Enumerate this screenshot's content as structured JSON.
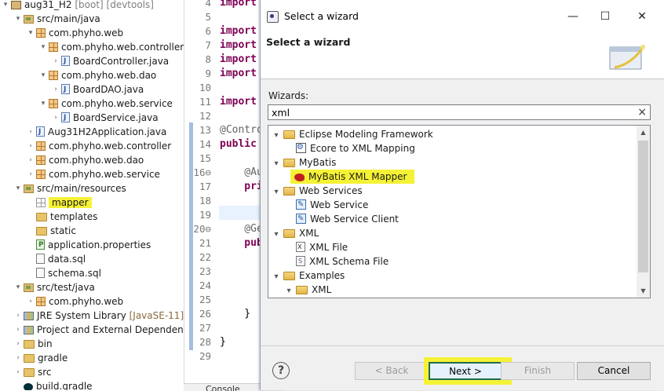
{
  "explorer": {
    "rows": [
      {
        "twisty": "▾",
        "icon": "project",
        "label": "aug31_H2",
        "suffix": " [boot] [devtools]"
      },
      {
        "twisty": "▾",
        "icon": "srcfolder",
        "label": "src/main/java"
      },
      {
        "twisty": "▾",
        "icon": "pkg",
        "label": "com.phyho.web"
      },
      {
        "twisty": "▾",
        "icon": "pkg",
        "label": "com.phyho.web.controller"
      },
      {
        "twisty": "›",
        "icon": "java",
        "label": "BoardController.java"
      },
      {
        "twisty": "▾",
        "icon": "pkg",
        "label": "com.phyho.web.dao"
      },
      {
        "twisty": "›",
        "icon": "java",
        "label": "BoardDAO.java"
      },
      {
        "twisty": "▾",
        "icon": "pkg",
        "label": "com.phyho.web.service"
      },
      {
        "twisty": "›",
        "icon": "java",
        "label": "BoardService.java"
      },
      {
        "twisty": "›",
        "icon": "java",
        "label": "Aug31H2Application.java"
      },
      {
        "twisty": "›",
        "icon": "pkg",
        "label": "com.phyho.web.controller"
      },
      {
        "twisty": "›",
        "icon": "pkg",
        "label": "com.phyho.web.dao"
      },
      {
        "twisty": "›",
        "icon": "pkg",
        "label": "com.phyho.web.service"
      },
      {
        "twisty": "▾",
        "icon": "srcfolder",
        "label": "src/main/resources"
      },
      {
        "twisty": "",
        "icon": "pkg-empty",
        "label": "mapper",
        "highlight": true
      },
      {
        "twisty": "",
        "icon": "folder",
        "label": "templates"
      },
      {
        "twisty": "",
        "icon": "folder",
        "label": "static"
      },
      {
        "twisty": "",
        "icon": "props",
        "label": "application.properties"
      },
      {
        "twisty": "",
        "icon": "file",
        "label": "data.sql"
      },
      {
        "twisty": "",
        "icon": "file",
        "label": "schema.sql"
      },
      {
        "twisty": "▾",
        "icon": "srcfolder",
        "label": "src/test/java"
      },
      {
        "twisty": "›",
        "icon": "pkg",
        "label": "com.phyho.web"
      },
      {
        "twisty": "›",
        "icon": "lib",
        "label": "JRE System Library",
        "suffix": " [JavaSE-11]"
      },
      {
        "twisty": "›",
        "icon": "lib",
        "label": "Project and External Dependencies"
      },
      {
        "twisty": "›",
        "icon": "folder",
        "label": "bin"
      },
      {
        "twisty": "›",
        "icon": "folder",
        "label": "gradle"
      },
      {
        "twisty": "›",
        "icon": "folder",
        "label": "src"
      },
      {
        "twisty": "",
        "icon": "gradle",
        "label": "build.gradle"
      }
    ]
  },
  "editor": {
    "lines": [
      {
        "n": "4",
        "code": "import java.util.Map;"
      },
      {
        "n": "5",
        "code": ""
      },
      {
        "n": "6",
        "code": "import"
      },
      {
        "n": "7",
        "code": "import"
      },
      {
        "n": "8",
        "code": "import"
      },
      {
        "n": "9",
        "code": "import"
      },
      {
        "n": "10",
        "code": ""
      },
      {
        "n": "11",
        "code": "import"
      },
      {
        "n": "12",
        "code": ""
      },
      {
        "n": "13",
        "code": "@Contro"
      },
      {
        "n": "14",
        "code": "public"
      },
      {
        "n": "15",
        "code": ""
      },
      {
        "n": "16⊖",
        "code": "    @Au"
      },
      {
        "n": "17",
        "code": "    pri"
      },
      {
        "n": "18",
        "code": ""
      },
      {
        "n": "19",
        "code": ""
      },
      {
        "n": "20⊖",
        "code": "    @Ge"
      },
      {
        "n": "21",
        "code": "    pub"
      },
      {
        "n": "22",
        "code": ""
      },
      {
        "n": "23",
        "code": ""
      },
      {
        "n": "24",
        "code": ""
      },
      {
        "n": "25",
        "code": ""
      },
      {
        "n": "26",
        "code": "    }"
      },
      {
        "n": "27",
        "code": ""
      },
      {
        "n": "28",
        "code": "}"
      },
      {
        "n": "29",
        "code": ""
      }
    ],
    "console_tab": "Console"
  },
  "dialog": {
    "title": "Select a wizard",
    "header": "Select a wizard",
    "wizards_label": "Wizards:",
    "filter_value": "xml",
    "clear_glyph": "×",
    "minimize_glyph": "—",
    "maximize_glyph": "☐",
    "close_glyph": "✕",
    "tree": [
      {
        "indent": 0,
        "twisty": "▾",
        "icon": "folder",
        "label": "Eclipse Modeling Framework"
      },
      {
        "indent": 1,
        "twisty": "",
        "icon": "ecore",
        "label": "Ecore to XML Mapping"
      },
      {
        "indent": 0,
        "twisty": "▾",
        "icon": "folder",
        "label": "MyBatis"
      },
      {
        "indent": 1,
        "twisty": "",
        "icon": "bird",
        "label": "MyBatis XML Mapper",
        "highlight": true
      },
      {
        "indent": 0,
        "twisty": "▾",
        "icon": "folder",
        "label": "Web Services"
      },
      {
        "indent": 1,
        "twisty": "",
        "icon": "ws",
        "label": "Web Service"
      },
      {
        "indent": 1,
        "twisty": "",
        "icon": "ws",
        "label": "Web Service Client"
      },
      {
        "indent": 0,
        "twisty": "▾",
        "icon": "folder",
        "label": "XML"
      },
      {
        "indent": 1,
        "twisty": "",
        "icon": "xml",
        "label": "XML File"
      },
      {
        "indent": 1,
        "twisty": "",
        "icon": "xsd",
        "label": "XML Schema File"
      },
      {
        "indent": 0,
        "twisty": "▾",
        "icon": "folder",
        "label": "Examples"
      },
      {
        "indent": 1,
        "twisty": "▾",
        "icon": "folder",
        "label": "XML"
      }
    ],
    "buttons": {
      "help": "?",
      "back": "< Back",
      "next": "Next >",
      "finish": "Finish",
      "cancel": "Cancel"
    },
    "highlight_color": "#f5f236"
  }
}
